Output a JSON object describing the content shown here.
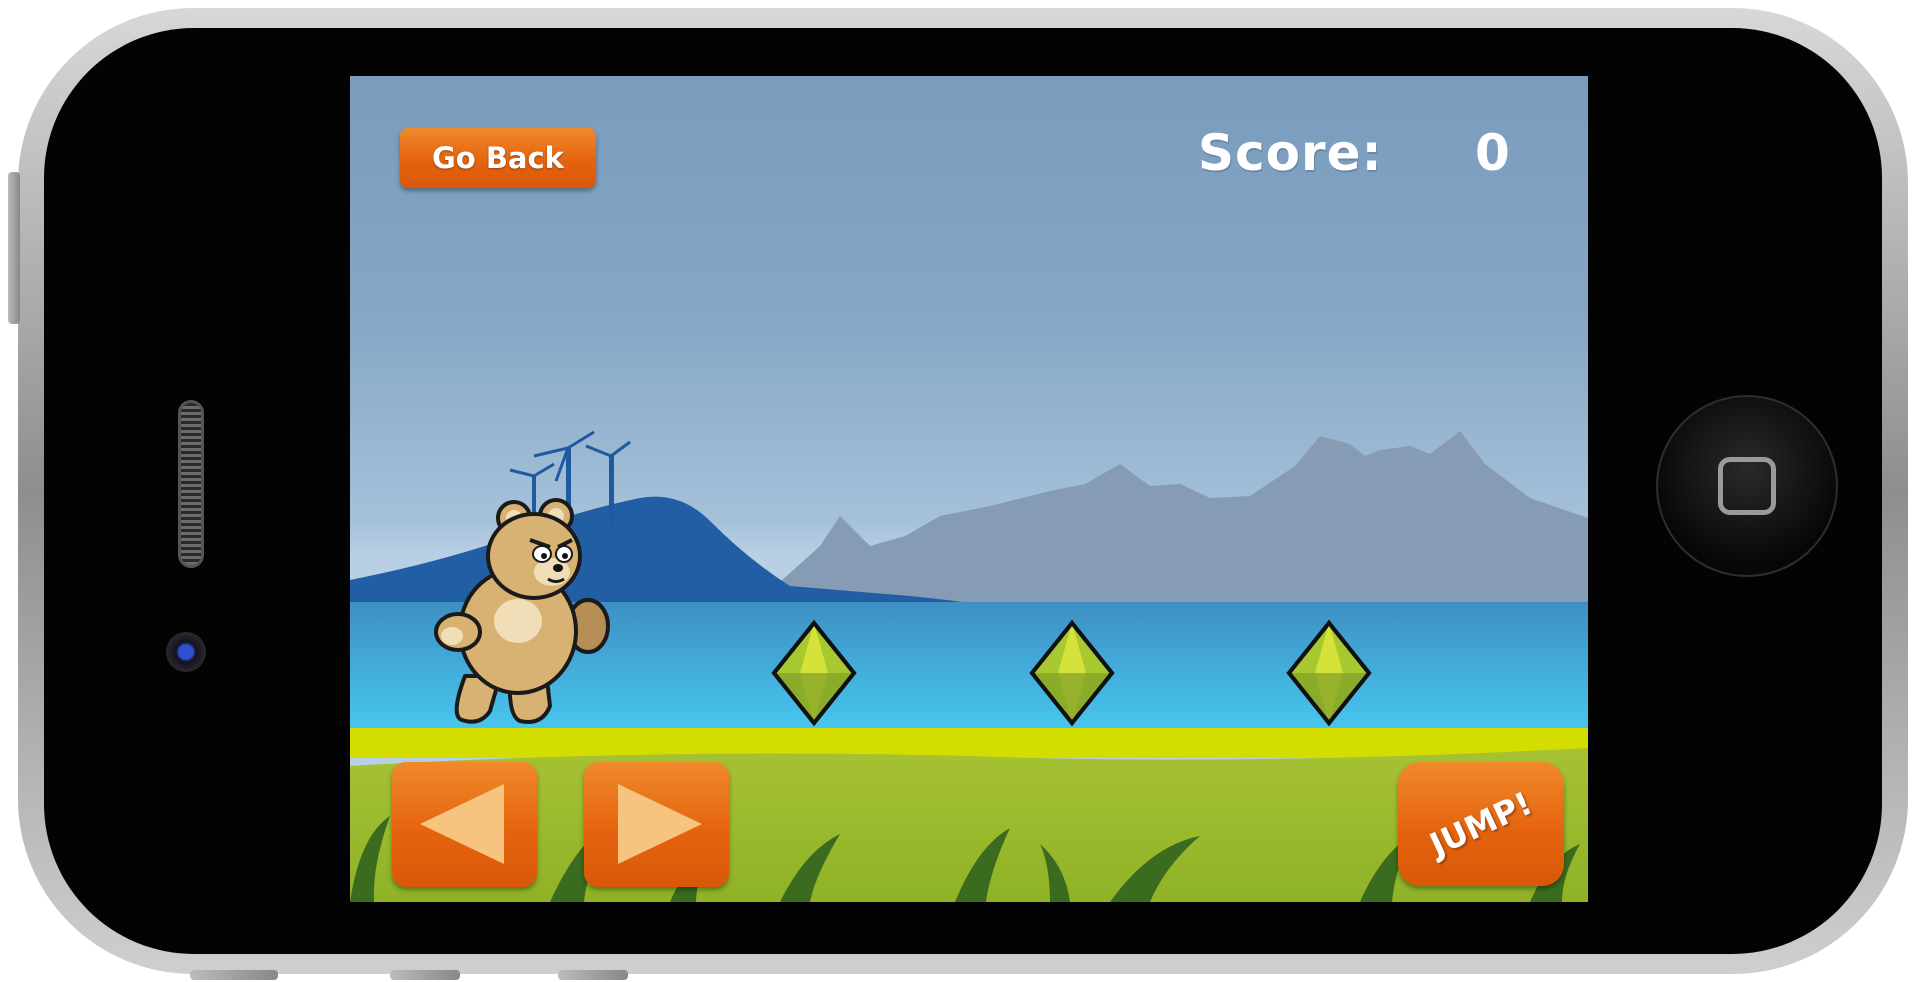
{
  "hud": {
    "back_label": "Go Back",
    "score_label": "Score:",
    "score_value": "0"
  },
  "controls": {
    "left_icon": "left-arrow-icon",
    "right_icon": "right-arrow-icon",
    "jump_label": "JUMP!"
  },
  "colors": {
    "button_orange": "#e5630f",
    "arrow_fill": "#f6c47f",
    "sky": "#7a9cbd",
    "water": "#3cb0e2",
    "grass": "#9dbb2c",
    "grass_strip": "#d4dd00",
    "gem_green": "#a8c830"
  },
  "game": {
    "gems": 3,
    "character": "teddy-bear"
  }
}
